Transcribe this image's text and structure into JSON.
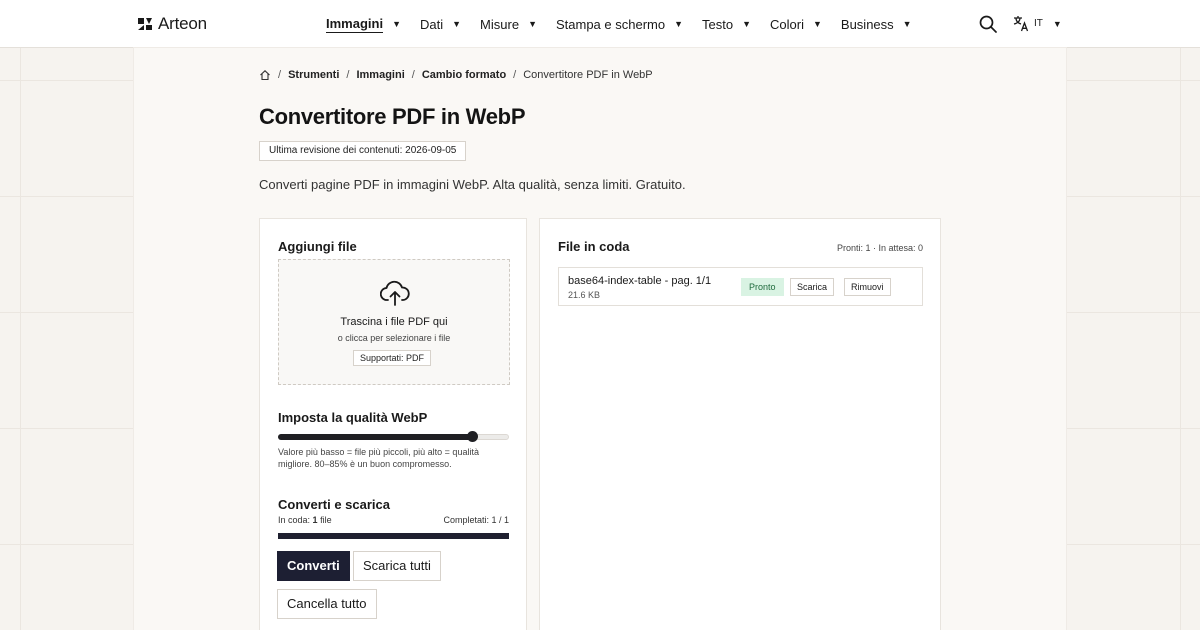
{
  "header": {
    "brand": "Arteon",
    "nav": [
      {
        "label": "Immagini",
        "active": true
      },
      {
        "label": "Dati"
      },
      {
        "label": "Misure"
      },
      {
        "label": "Stampa e schermo"
      },
      {
        "label": "Testo"
      },
      {
        "label": "Colori"
      },
      {
        "label": "Business"
      }
    ],
    "nav_caret": "▼",
    "language": "IT",
    "icons": {
      "search": "search-icon",
      "translate": "translate-icon",
      "logo": "logo-icon"
    }
  },
  "breadcrumb": {
    "home_icon": "home-icon",
    "separator": "/",
    "items": [
      "Strumenti",
      "Immagini",
      "Cambio formato"
    ],
    "current": "Convertitore PDF in WebP"
  },
  "page": {
    "title": "Convertitore PDF in WebP",
    "revision": "Ultima revisione dei contenuti: 2026-09-05",
    "lead": "Converti pagine PDF in immagini WebP. Alta qualità, senza limiti. Gratuito."
  },
  "upload": {
    "title": "Aggiungi file",
    "drop_main": "Trascina i file PDF qui",
    "drop_sub": "o clicca per selezionare i file",
    "supported": "Supportati: PDF",
    "icon": "cloud-upload-icon"
  },
  "quality": {
    "title": "Imposta la qualità WebP",
    "value_fraction": 0.84,
    "hint": "Valore più basso = file più piccoli, più alto = qualità migliore. 80–85% è un buon compromesso."
  },
  "convert": {
    "title": "Converti e scarica",
    "queued_label": "In coda:",
    "queued_value": "1",
    "queued_unit": "file",
    "completed": "Completati: 1 / 1",
    "progress_fraction": 1.0,
    "btn_convert": "Converti",
    "btn_download_all": "Scarica tutti",
    "btn_clear": "Cancella tutto"
  },
  "queue": {
    "title": "File in coda",
    "status": "Pronti: 1 · In attesa: 0",
    "files": [
      {
        "name": "base64-index-table - pag. 1/1",
        "size": "21.6 KB",
        "status": "Pronto",
        "download": "Scarica",
        "remove": "Rimuovi"
      }
    ]
  },
  "colors": {
    "accent": "#1d1f33",
    "ready_bg": "#d9f3e3",
    "ready_text": "#1f6b3d",
    "page_bg": "#f6f3ef"
  }
}
